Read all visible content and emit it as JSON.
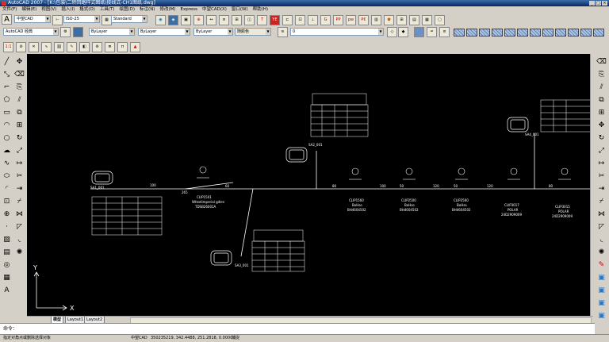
{
  "window": {
    "title": "AutoCAD 2007 - [K:\\包装\\二转回路样式图纸\\接线式-CH1图纸.dwg]"
  },
  "menu": [
    "文件(F)",
    "编辑(E)",
    "视图(V)",
    "插入(I)",
    "格式(O)",
    "工具(T)",
    "绘图(D)",
    "标注(N)",
    "修改(M)",
    "Express",
    "中望CAD(X)",
    "窗口(W)",
    "帮助(H)"
  ],
  "toolbar": {
    "text_style": "中望CAD",
    "dim_style": "ISO-25",
    "table_style": "Standard",
    "workspace": "AutoCAD 经典",
    "color": "ByLayer",
    "linetype": "ByLayer",
    "lineweight": "ByLayer",
    "plot_style": "随颜色",
    "layer": "0"
  },
  "drawing": {
    "connectors": [
      {
        "id": "SA1_001"
      },
      {
        "id": "SA2_001"
      },
      {
        "id": "SA3_001"
      },
      {
        "id": "SA4_001"
      }
    ],
    "clips": [
      {
        "name": "CLIP1501",
        "desc": "Wheelimperial gdlen",
        "code": "TDSB26001A"
      },
      {
        "name": "CLIP1560",
        "desc": "BoHso",
        "code": "BH4604502"
      },
      {
        "name": "CLIP2500",
        "desc": "BoHso",
        "code": "BH4604502"
      },
      {
        "name": "CLIP2560",
        "desc": "BoHso",
        "code": "BH4604502"
      },
      {
        "name": "CLIP3017",
        "desc": "POLAR",
        "code": "24D2909009"
      },
      {
        "name": "CLIP3015",
        "desc": "POLAR",
        "code": "24D2909009"
      }
    ],
    "segment_labels": [
      "100",
      "265",
      "60",
      "80",
      "100",
      "50",
      "120",
      "50",
      "120",
      "80"
    ],
    "ucs_x": "X",
    "ucs_y": "Y"
  },
  "tabs": [
    "模型",
    "Layout1",
    "Layout2"
  ],
  "command": {
    "prompt": "命令："
  },
  "status": {
    "left": "指定对角点或删除选择对象",
    "app": "中望CAD",
    "coords": "350235219, 342.4488, 251.2818, 0.0000",
    "mode": "捕捉"
  }
}
